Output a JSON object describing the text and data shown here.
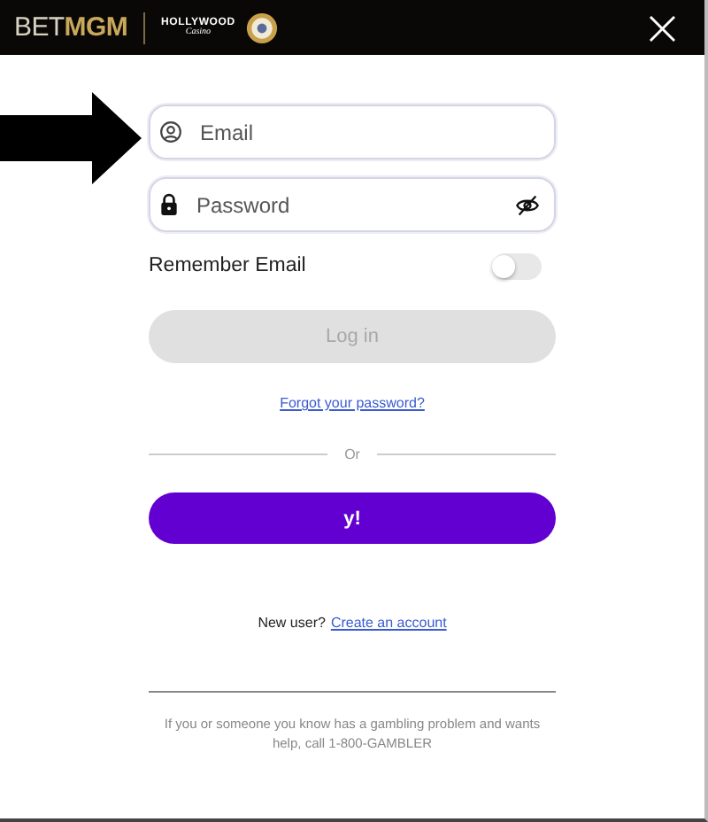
{
  "header": {
    "logo": {
      "light": "BET",
      "bold": "MGM"
    },
    "partner": {
      "name": "HOLLYWOOD",
      "script": "Casino"
    },
    "close": "×"
  },
  "annotation": {
    "kind": "arrow"
  },
  "form": {
    "fields": [
      {
        "kind": "email",
        "placeholder": "Email"
      },
      {
        "kind": "password",
        "placeholder": "Password"
      }
    ],
    "remember": {
      "label": "Remember Email",
      "on": false
    },
    "login": {
      "label": "Log in",
      "disabled": true
    },
    "forgot": "Forgot your password?",
    "divider": "Or",
    "yahoo": {
      "label": "y!"
    },
    "signup": {
      "prompt": "New user?",
      "link": "Create an account"
    },
    "disclaimer": "If you or someone you know has a gambling problem and wants help, call 1-800-GAMBLER"
  }
}
